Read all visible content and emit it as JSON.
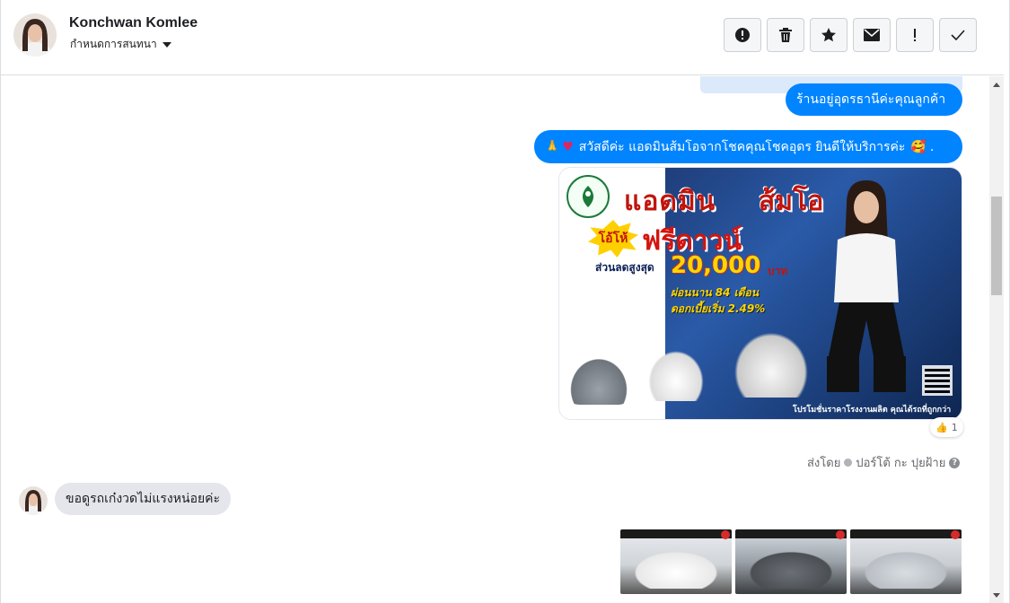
{
  "header": {
    "contact_name": "Konchwan Komlee",
    "label_dropdown": "กำหนดการสนทนา",
    "toolbar": [
      {
        "name": "report-spam-button",
        "icon": "alert-circle-icon"
      },
      {
        "name": "delete-button",
        "icon": "trash-icon"
      },
      {
        "name": "star-button",
        "icon": "star-icon"
      },
      {
        "name": "mark-unread-button",
        "icon": "envelope-icon"
      },
      {
        "name": "follow-up-button",
        "icon": "exclamation-icon"
      },
      {
        "name": "mark-done-button",
        "icon": "checkmark-icon"
      }
    ]
  },
  "messages": {
    "out_1": "ร้านอยู่อุดรธานีค่ะคุณลูกค้า",
    "out_2_text": "สวัสดีค่ะ แอดมินส้มโอจากโชคคุณโชคอุดร ยินดีให้บริการค่ะ",
    "out_2_suffix": ".",
    "reaction_count": "1",
    "sent_by_label": "ส่งโดย",
    "sent_by_name": "ปอร์โต้ กะ ปุยฝ้าย",
    "in_1": "ขอดูรถเก๋งวดไม่แรงหน่อยค่ะ"
  },
  "promo": {
    "title_a": "แอดมิน",
    "title_b": "ส้มโอ",
    "burst": "โอ้โห้",
    "free": "ฟรีดาวน์",
    "discount_label": "ส่วนลดสูงสุด",
    "amount": "20,000",
    "currency": "บาท",
    "installment": "ผ่อนนาน 84 เดือน",
    "interest": "ดอกเบี้ยเริ่ม 2.49%",
    "footer": "โปรโมชั่นราคาโรงงานผลิต คุณได้รถที่ถูกกว่า"
  },
  "colors": {
    "out_bubble": "#0084ff",
    "in_bubble": "#e4e6eb",
    "accent_red": "#c0140c",
    "accent_yellow": "#ffd400"
  }
}
